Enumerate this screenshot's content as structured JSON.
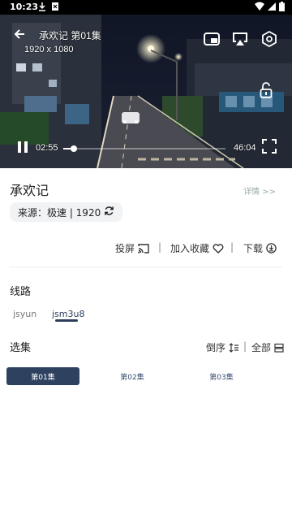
{
  "status_bar": {
    "time": "10:23"
  },
  "player": {
    "title": "承欢记 第01集",
    "resolution": "1920 x 1080",
    "current_time": "02:55",
    "duration": "46:04",
    "progress": 0.063,
    "icons": [
      "back-arrow-icon",
      "pip-icon",
      "airplay-icon",
      "settings-hex-icon",
      "unlock-icon",
      "pause-icon",
      "fullscreen-icon"
    ]
  },
  "info": {
    "title": "承欢记",
    "detail_link": "详情 >>",
    "source_label": "来源：极速 | 1920",
    "actions": {
      "cast": "投屏",
      "favorite": "加入收藏",
      "download": "下载"
    },
    "routes_title": "线路",
    "routes": [
      "jsyun",
      "jsm3u8"
    ],
    "selected_route": "jsm3u8",
    "episodes_title": "选集",
    "sort_label": "倒序",
    "all_label": "全部",
    "episodes": [
      "第01集",
      "第02集",
      "第03集"
    ],
    "selected_episode": "第01集"
  },
  "colors": {
    "accent": "#2e4260",
    "status_bg": "#000000"
  }
}
